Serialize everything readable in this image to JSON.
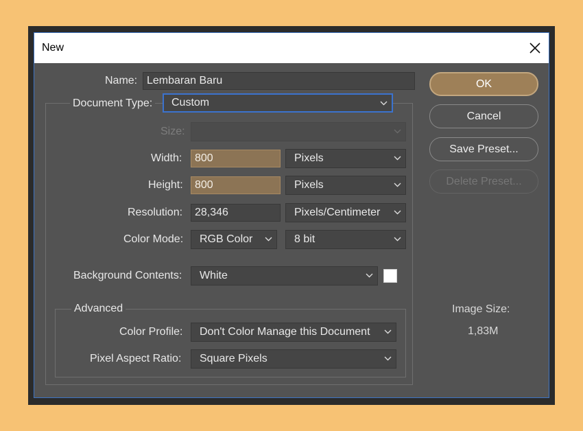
{
  "window": {
    "title": "New"
  },
  "form": {
    "name": {
      "label": "Name:",
      "value": "Lembaran Baru"
    },
    "document_type": {
      "label": "Document Type:",
      "value": "Custom"
    },
    "size": {
      "label": "Size:",
      "value": ""
    },
    "width": {
      "label": "Width:",
      "value": "800",
      "unit": "Pixels"
    },
    "height": {
      "label": "Height:",
      "value": "800",
      "unit": "Pixels"
    },
    "resolution": {
      "label": "Resolution:",
      "value": "28,346",
      "unit": "Pixels/Centimeter"
    },
    "color_mode": {
      "label": "Color Mode:",
      "value": "RGB Color",
      "depth": "8 bit"
    },
    "background_contents": {
      "label": "Background Contents:",
      "value": "White",
      "swatch_color": "#ffffff"
    }
  },
  "advanced": {
    "title": "Advanced",
    "color_profile": {
      "label": "Color Profile:",
      "value": "Don't Color Manage this Document"
    },
    "pixel_aspect_ratio": {
      "label": "Pixel Aspect Ratio:",
      "value": "Square Pixels"
    }
  },
  "buttons": {
    "ok": "OK",
    "cancel": "Cancel",
    "save_preset": "Save Preset...",
    "delete_preset": "Delete Preset..."
  },
  "image_size": {
    "label": "Image Size:",
    "value": "1,83M"
  },
  "colors": {
    "accent": "#9e8058",
    "field_accent": "#8c7455",
    "focus": "#3b73cf",
    "dialog_bg": "#535353",
    "page_bg": "#f7c274"
  },
  "icons": {
    "close": "close-icon",
    "dropdown": "chevron-down-icon"
  }
}
